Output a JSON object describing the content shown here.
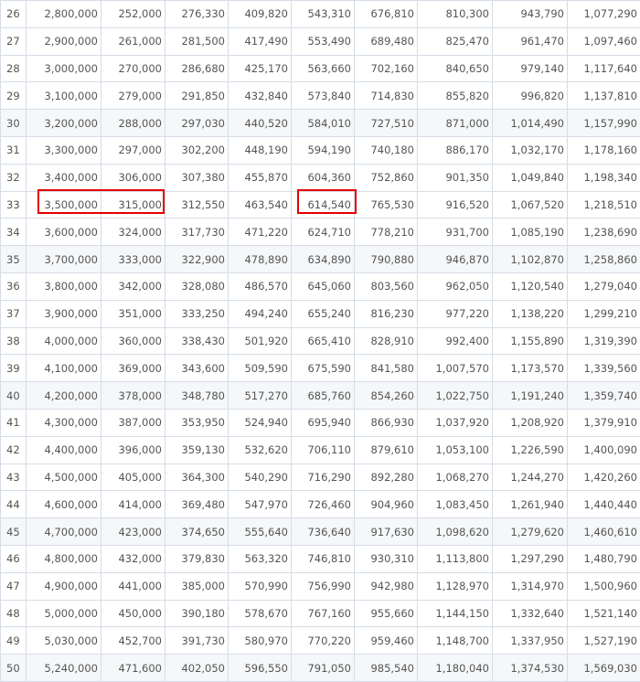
{
  "table": {
    "rows": [
      [
        "26",
        "2,800,000",
        "252,000",
        "276,330",
        "409,820",
        "543,310",
        "676,810",
        "810,300",
        "943,790",
        "1,077,290"
      ],
      [
        "27",
        "2,900,000",
        "261,000",
        "281,500",
        "417,490",
        "553,490",
        "689,480",
        "825,470",
        "961,470",
        "1,097,460"
      ],
      [
        "28",
        "3,000,000",
        "270,000",
        "286,680",
        "425,170",
        "563,660",
        "702,160",
        "840,650",
        "979,140",
        "1,117,640"
      ],
      [
        "29",
        "3,100,000",
        "279,000",
        "291,850",
        "432,840",
        "573,840",
        "714,830",
        "855,820",
        "996,820",
        "1,137,810"
      ],
      [
        "30",
        "3,200,000",
        "288,000",
        "297,030",
        "440,520",
        "584,010",
        "727,510",
        "871,000",
        "1,014,490",
        "1,157,990"
      ],
      [
        "31",
        "3,300,000",
        "297,000",
        "302,200",
        "448,190",
        "594,190",
        "740,180",
        "886,170",
        "1,032,170",
        "1,178,160"
      ],
      [
        "32",
        "3,400,000",
        "306,000",
        "307,380",
        "455,870",
        "604,360",
        "752,860",
        "901,350",
        "1,049,840",
        "1,198,340"
      ],
      [
        "33",
        "3,500,000",
        "315,000",
        "312,550",
        "463,540",
        "614,540",
        "765,530",
        "916,520",
        "1,067,520",
        "1,218,510"
      ],
      [
        "34",
        "3,600,000",
        "324,000",
        "317,730",
        "471,220",
        "624,710",
        "778,210",
        "931,700",
        "1,085,190",
        "1,238,690"
      ],
      [
        "35",
        "3,700,000",
        "333,000",
        "322,900",
        "478,890",
        "634,890",
        "790,880",
        "946,870",
        "1,102,870",
        "1,258,860"
      ],
      [
        "36",
        "3,800,000",
        "342,000",
        "328,080",
        "486,570",
        "645,060",
        "803,560",
        "962,050",
        "1,120,540",
        "1,279,040"
      ],
      [
        "37",
        "3,900,000",
        "351,000",
        "333,250",
        "494,240",
        "655,240",
        "816,230",
        "977,220",
        "1,138,220",
        "1,299,210"
      ],
      [
        "38",
        "4,000,000",
        "360,000",
        "338,430",
        "501,920",
        "665,410",
        "828,910",
        "992,400",
        "1,155,890",
        "1,319,390"
      ],
      [
        "39",
        "4,100,000",
        "369,000",
        "343,600",
        "509,590",
        "675,590",
        "841,580",
        "1,007,570",
        "1,173,570",
        "1,339,560"
      ],
      [
        "40",
        "4,200,000",
        "378,000",
        "348,780",
        "517,270",
        "685,760",
        "854,260",
        "1,022,750",
        "1,191,240",
        "1,359,740"
      ],
      [
        "41",
        "4,300,000",
        "387,000",
        "353,950",
        "524,940",
        "695,940",
        "866,930",
        "1,037,920",
        "1,208,920",
        "1,379,910"
      ],
      [
        "42",
        "4,400,000",
        "396,000",
        "359,130",
        "532,620",
        "706,110",
        "879,610",
        "1,053,100",
        "1,226,590",
        "1,400,090"
      ],
      [
        "43",
        "4,500,000",
        "405,000",
        "364,300",
        "540,290",
        "716,290",
        "892,280",
        "1,068,270",
        "1,244,270",
        "1,420,260"
      ],
      [
        "44",
        "4,600,000",
        "414,000",
        "369,480",
        "547,970",
        "726,460",
        "904,960",
        "1,083,450",
        "1,261,940",
        "1,440,440"
      ],
      [
        "45",
        "4,700,000",
        "423,000",
        "374,650",
        "555,640",
        "736,640",
        "917,630",
        "1,098,620",
        "1,279,620",
        "1,460,610"
      ],
      [
        "46",
        "4,800,000",
        "432,000",
        "379,830",
        "563,320",
        "746,810",
        "930,310",
        "1,113,800",
        "1,297,290",
        "1,480,790"
      ],
      [
        "47",
        "4,900,000",
        "441,000",
        "385,000",
        "570,990",
        "756,990",
        "942,980",
        "1,128,970",
        "1,314,970",
        "1,500,960"
      ],
      [
        "48",
        "5,000,000",
        "450,000",
        "390,180",
        "578,670",
        "767,160",
        "955,660",
        "1,144,150",
        "1,332,640",
        "1,521,140"
      ],
      [
        "49",
        "5,030,000",
        "452,700",
        "391,730",
        "580,970",
        "770,220",
        "959,460",
        "1,148,700",
        "1,337,950",
        "1,527,190"
      ],
      [
        "50",
        "5,240,000",
        "471,600",
        "402,050",
        "596,550",
        "791,050",
        "985,540",
        "1,180,040",
        "1,374,530",
        "1,569,030"
      ]
    ],
    "alt_row_indices": [
      4,
      9,
      14,
      19,
      24
    ]
  },
  "highlights": {
    "color": "#e30000",
    "marked_row": "33",
    "marked_values": [
      "3,500,000",
      "315,000",
      "614,540"
    ]
  }
}
